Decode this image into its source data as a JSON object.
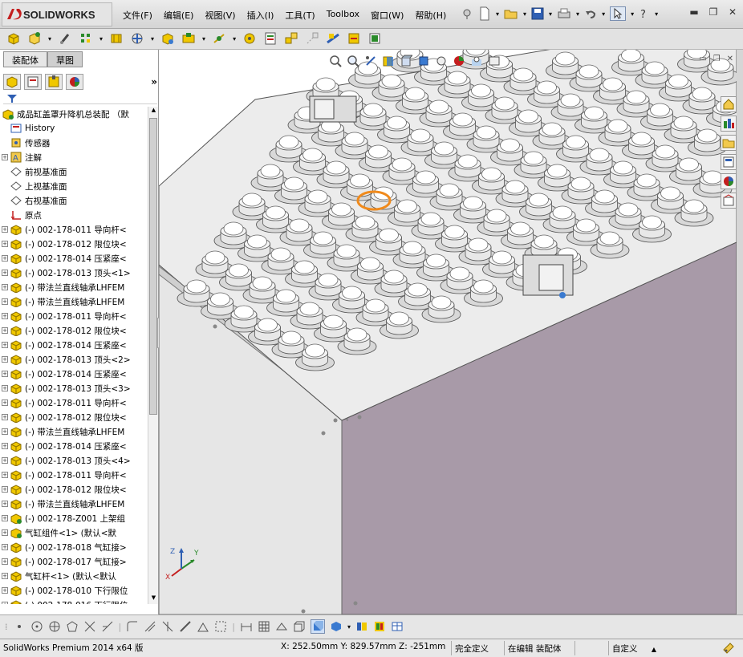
{
  "app": {
    "logo_prefix": "DS",
    "logo_name": "SOLIDWORKS"
  },
  "menu": [
    {
      "label": "文件(F)"
    },
    {
      "label": "编辑(E)"
    },
    {
      "label": "视图(V)"
    },
    {
      "label": "插入(I)"
    },
    {
      "label": "工具(T)"
    },
    {
      "label": "Toolbox"
    },
    {
      "label": "窗口(W)"
    },
    {
      "label": "帮助(H)"
    }
  ],
  "panel_tabs": [
    {
      "label": "装配体",
      "active": true
    },
    {
      "label": "草图",
      "active": false
    }
  ],
  "tree": {
    "root": "成品缸盖罩升降机总装配 （默",
    "items": [
      {
        "label": "History",
        "icon": "history-icon",
        "expand": false
      },
      {
        "label": "传感器",
        "icon": "sensor-icon",
        "expand": false
      },
      {
        "label": "注解",
        "icon": "annotation-icon",
        "expand": true
      },
      {
        "label": "前视基准面",
        "icon": "plane-icon",
        "expand": false
      },
      {
        "label": "上视基准面",
        "icon": "plane-icon",
        "expand": false
      },
      {
        "label": "右视基准面",
        "icon": "plane-icon",
        "expand": false
      },
      {
        "label": "原点",
        "icon": "origin-icon",
        "expand": false
      },
      {
        "label": "(-) 002-178-011 导向杆<",
        "icon": "part-icon",
        "expand": true
      },
      {
        "label": "(-) 002-178-012 限位块<",
        "icon": "part-icon",
        "expand": true
      },
      {
        "label": "(-) 002-178-014 压紧座<",
        "icon": "part-icon",
        "expand": true
      },
      {
        "label": "(-) 002-178-013 顶头<1>",
        "icon": "part-icon",
        "expand": true
      },
      {
        "label": "(-) 带法兰直线轴承LHFEM",
        "icon": "part-icon",
        "expand": true
      },
      {
        "label": "(-) 带法兰直线轴承LHFEM",
        "icon": "part-icon",
        "expand": true
      },
      {
        "label": "(-) 002-178-011 导向杆<",
        "icon": "part-icon",
        "expand": true
      },
      {
        "label": "(-) 002-178-012 限位块<",
        "icon": "part-icon",
        "expand": true
      },
      {
        "label": "(-) 002-178-014 压紧座<",
        "icon": "part-icon",
        "expand": true
      },
      {
        "label": "(-) 002-178-013 顶头<2>",
        "icon": "part-icon",
        "expand": true
      },
      {
        "label": "(-) 002-178-014 压紧座<",
        "icon": "part-icon",
        "expand": true
      },
      {
        "label": "(-) 002-178-013 顶头<3>",
        "icon": "part-icon",
        "expand": true
      },
      {
        "label": "(-) 002-178-011 导向杆<",
        "icon": "part-icon",
        "expand": true
      },
      {
        "label": "(-) 002-178-012 限位块<",
        "icon": "part-icon",
        "expand": true
      },
      {
        "label": "(-) 带法兰直线轴承LHFEM",
        "icon": "part-icon",
        "expand": true
      },
      {
        "label": "(-) 002-178-014 压紧座<",
        "icon": "part-icon",
        "expand": true
      },
      {
        "label": "(-) 002-178-013 顶头<4>",
        "icon": "part-icon",
        "expand": true
      },
      {
        "label": "(-) 002-178-011 导向杆<",
        "icon": "part-icon",
        "expand": true
      },
      {
        "label": "(-) 002-178-012 限位块<",
        "icon": "part-icon",
        "expand": true
      },
      {
        "label": "(-) 带法兰直线轴承LHFEM",
        "icon": "part-icon",
        "expand": true
      },
      {
        "label": "(-) 002-178-Z001 上架组",
        "icon": "assembly-icon",
        "expand": true
      },
      {
        "label": "气缸组件<1> (默认<默",
        "icon": "assembly-icon",
        "expand": true
      },
      {
        "label": "(-) 002-178-018 气缸接>",
        "icon": "part-icon",
        "expand": true
      },
      {
        "label": "(-) 002-178-017 气缸接>",
        "icon": "part-icon",
        "expand": true
      },
      {
        "label": "气缸杆<1> (默认<默认",
        "icon": "part-icon",
        "expand": true
      },
      {
        "label": "(-) 002-178-010 下行限位",
        "icon": "part-icon",
        "expand": true
      },
      {
        "label": "(-) 002-178-016 下行限位",
        "icon": "part-icon",
        "expand": true
      }
    ]
  },
  "triad": {
    "x": "X",
    "y": "Y",
    "z": "Z"
  },
  "status": {
    "product": "SolidWorks Premium 2014 x64 版",
    "coords": "X: 252.50mm Y: 829.57mm Z: -251mm",
    "definition": "完全定义",
    "mode": "在编辑 装配体",
    "units": "自定义",
    "units_arrow": "▲"
  },
  "colors": {
    "panel_gray": "#d6d6d6",
    "body_purple": "#a89aa8",
    "side_gray": "#e6e6e6",
    "highlight": "#f08a1c",
    "part_yellow": "#f0c800"
  },
  "icons": {
    "toolbar": [
      "new-icon",
      "open-icon",
      "save-icon",
      "print-icon",
      "undo-icon",
      "select-icon",
      "rebuild-icon",
      "help-icon"
    ],
    "view_toolbar": [
      "zoom-fit-icon",
      "zoom-area-icon",
      "previous-view-icon",
      "section-view-icon",
      "view-orientation-icon",
      "display-style-icon",
      "hide-show-icon",
      "appearance-icon",
      "scene-icon",
      "view-settings-icon"
    ]
  }
}
